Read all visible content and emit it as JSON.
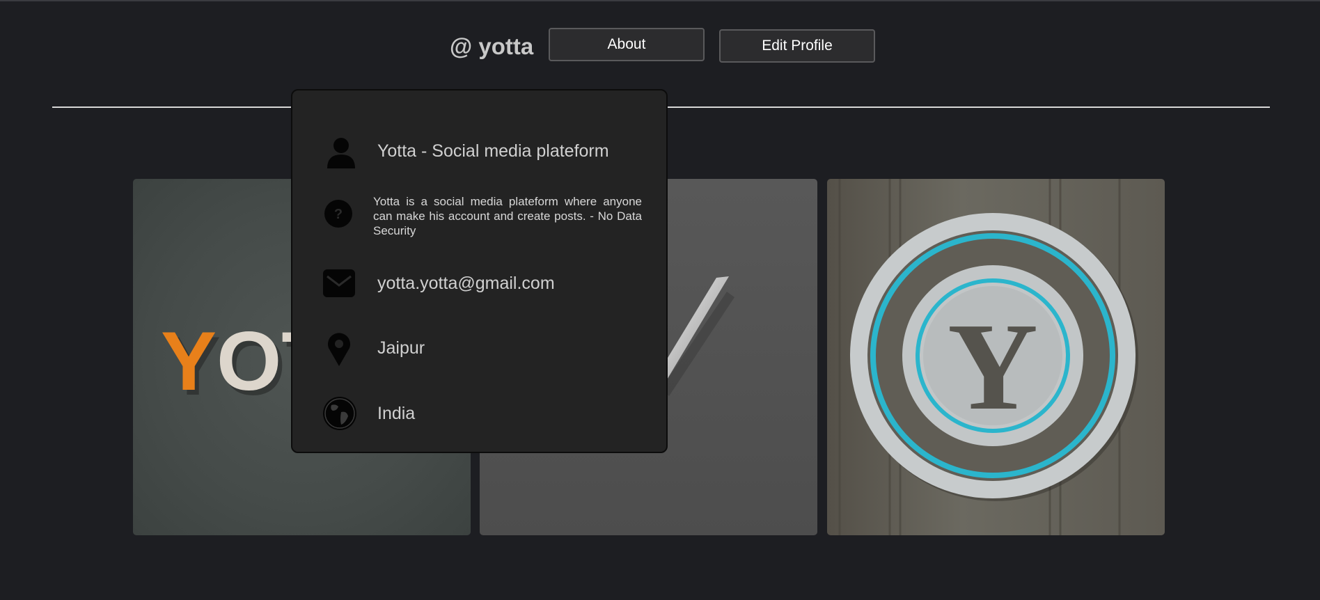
{
  "header": {
    "username": "@ yotta",
    "about_label": "About",
    "edit_profile_label": "Edit Profile"
  },
  "about_popup": {
    "items": [
      {
        "icon": "user-icon",
        "text": "Yotta - Social media plateform"
      },
      {
        "icon": "question-icon",
        "text": "Yotta is a social media plateform where anyone can make his account and create posts. - No Data Security"
      },
      {
        "icon": "mail-icon",
        "text": "yotta.yotta@gmail.com"
      },
      {
        "icon": "location-pin-icon",
        "text": "Jaipur"
      },
      {
        "icon": "globe-icon",
        "text": "India"
      }
    ]
  },
  "posts": [
    {
      "image": "yotta-wordmark-logo",
      "logo_text": "YOTTA"
    },
    {
      "image": "yotta-check-logo"
    },
    {
      "image": "yotta-emblem-logo",
      "logo_text": "Y"
    }
  ],
  "colors": {
    "background": "#1d1e22",
    "popup_bg": "#232323",
    "button_bg": "#2c2c2e",
    "logo_orange": "#e8801a",
    "emblem_accent": "#2bb5cc"
  }
}
